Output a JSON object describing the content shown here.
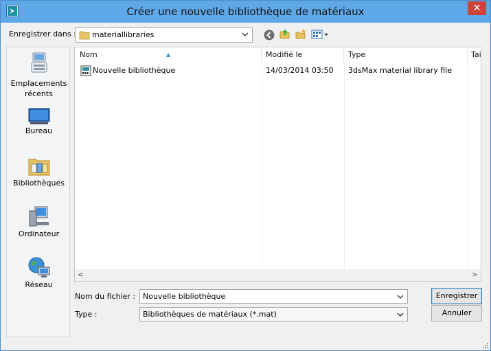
{
  "window": {
    "title": "Créer une nouvelle bibliothèque de matériaux",
    "app_icon": "3ds-max-icon",
    "close_glyph": "✕",
    "accent_color": "#5fa8e8",
    "close_color": "#c7463b"
  },
  "toolbar": {
    "save_in_label": "Enregistrer dans :",
    "save_in_label_hotkey": "d",
    "location": "materiallibraries",
    "nav_icons": [
      "back-icon",
      "up-folder-icon",
      "new-folder-icon",
      "view-menu-icon"
    ]
  },
  "places": [
    {
      "label": "Emplacements récents",
      "icon": "recent-places-icon"
    },
    {
      "label": "Bureau",
      "icon": "desktop-icon"
    },
    {
      "label": "Bibliothèques",
      "icon": "libraries-icon"
    },
    {
      "label": "Ordinateur",
      "icon": "computer-icon"
    },
    {
      "label": "Réseau",
      "icon": "network-icon"
    }
  ],
  "filelist": {
    "columns": [
      "Nom",
      "Modifié le",
      "Type",
      "Tai"
    ],
    "sorted_column": "Nom",
    "rows": [
      {
        "name": "Nouvelle bibliothèque",
        "modified": "14/03/2014 03:50",
        "type": "3dsMax material library file",
        "icon": "material-library-file-icon"
      }
    ],
    "scroll_left": "<",
    "scroll_right": ">"
  },
  "form": {
    "filename_label": "Nom du fichier :",
    "filename_value": "Nouvelle bibliothèque",
    "type_label": "Type :",
    "type_value": "Bibliothèques de matériaux (*.mat)",
    "save_button": "Enregistrer",
    "cancel_button": "Annuler"
  }
}
